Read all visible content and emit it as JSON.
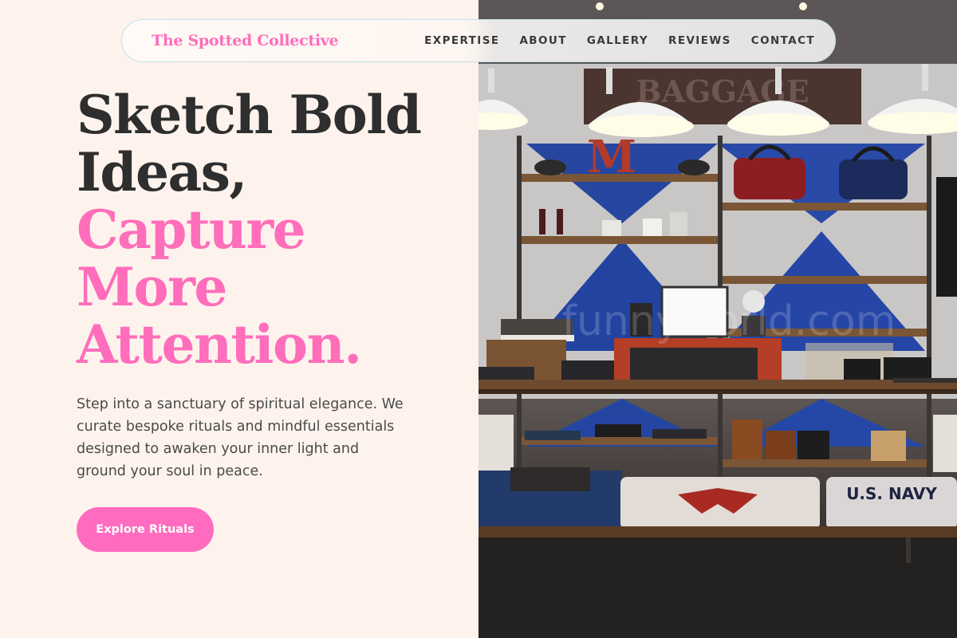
{
  "nav": {
    "brand": "The Spotted Collective",
    "links": [
      "EXPERTISE",
      "ABOUT",
      "GALLERY",
      "REVIEWS",
      "CONTACT"
    ]
  },
  "hero": {
    "title_dark_1": "Sketch Bold",
    "title_dark_2": "Ideas,",
    "title_pink_1": "Capture",
    "title_pink_2": "More",
    "title_pink_3": "Attention.",
    "description": "Step into a sanctuary of spiritual elegance. We curate bespoke rituals and mindful essentials designed to awaken your inner light and ground your soul in peace.",
    "cta_label": "Explore Rituals"
  },
  "photo": {
    "sign_text": "BAGGAGE",
    "watermark": "funnyworld.com",
    "shirt_text": "U.S. NAVY",
    "logo_letter": "M"
  },
  "colors": {
    "accent_pink": "#ff6dbb",
    "heading_dark": "#2e2e2e",
    "background_cream": "#fdf3ec",
    "nav_border": "#bfe1e6"
  }
}
